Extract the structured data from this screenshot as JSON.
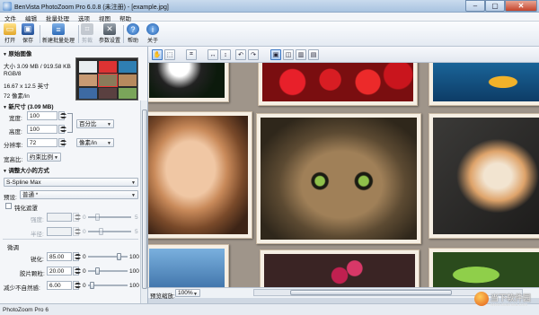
{
  "window": {
    "title": "BenVista PhotoZoom Pro 6.0.8 (未注册) - [example.jpg]",
    "controls": [
      "–",
      "▢",
      "✕"
    ]
  },
  "menu": [
    "文件",
    "编辑",
    "批量处理",
    "选项",
    "视图",
    "帮助"
  ],
  "toolbar": {
    "buttons": [
      {
        "label": "打开",
        "icon": "folder-open-icon",
        "enabled": true
      },
      {
        "label": "保存",
        "icon": "save-disk-icon",
        "enabled": true
      },
      {
        "label": "新建批量处理",
        "icon": "batch-stack-icon",
        "enabled": true
      },
      {
        "label": "剪裁",
        "icon": "crop-icon",
        "enabled": false
      },
      {
        "label": "参数设置",
        "icon": "tools-icon",
        "enabled": true
      },
      {
        "label": "帮助",
        "icon": "help-icon",
        "enabled": true
      },
      {
        "label": "关于",
        "icon": "info-icon",
        "enabled": true
      }
    ]
  },
  "left_panel": {
    "original": {
      "header": "原始图像",
      "size": "大小 3.09 MB / 919.58 KB",
      "mode": "RGB/8",
      "dims": "16.67 x 12.5 英寸",
      "resolution": "72 像素/in"
    },
    "new_size": {
      "header": "新尺寸 (3.09 MB)",
      "width_label": "宽度:",
      "width_value": "100",
      "height_label": "高度:",
      "height_value": "100",
      "unit": "百分比",
      "resolution_label": "分辨率:",
      "resolution_value": "72",
      "resolution_unit": "像素/in",
      "aspect_label": "宽高比:",
      "aspect_value": "约束比例"
    },
    "method": {
      "header": "调整大小的方式",
      "algorithm": "S-Spline Max",
      "preset_label": "预设:",
      "preset_value": "普通 *"
    },
    "sharpen": {
      "checkbox_label": "钝化遮罩",
      "strength_label": "强度:",
      "strength_min": "0",
      "strength_max": "5",
      "radius_label": "半径:",
      "radius_min": "0",
      "radius_max": "5"
    },
    "tuning": {
      "header": "微调",
      "sharpness_label": "锐化:",
      "sharpness_value": "85.00",
      "sharpness_min": "0",
      "sharpness_max": "100",
      "film_grain_label": "胶片颗粒:",
      "film_grain_value": "20.00",
      "film_grain_min": "0",
      "film_grain_max": "100",
      "artifact_label": "减少不自然感:",
      "artifact_value": "6.00",
      "artifact_min": "0",
      "artifact_max": "100"
    },
    "levels": {
      "sharpness": 0.85,
      "film_grain": 0.2,
      "artifact": 0.06
    }
  },
  "view_toolbar": {
    "icons": [
      "hand-pan-icon",
      "zoom-select-icon",
      "crop-view-icon",
      "flip-horizontal-icon",
      "flip-vertical-icon",
      "rotate-left-icon",
      "rotate-right-icon",
      "single-view-icon",
      "split-vertical-icon",
      "split-dual-icon",
      "split-horizontal-icon"
    ]
  },
  "preview_footer": {
    "zoom_label": "预览缩放:",
    "zoom_value": "100%"
  },
  "status": {
    "text": "PhotoZoom Pro 6"
  },
  "watermark": {
    "text": "当下软件园",
    "sub": "www.downxia.com"
  },
  "colors": {
    "title_bar": "#b5cde8",
    "accent_blue": "#3d78c4",
    "close_red": "#c4442b",
    "preview_bg": "#9f958a"
  }
}
